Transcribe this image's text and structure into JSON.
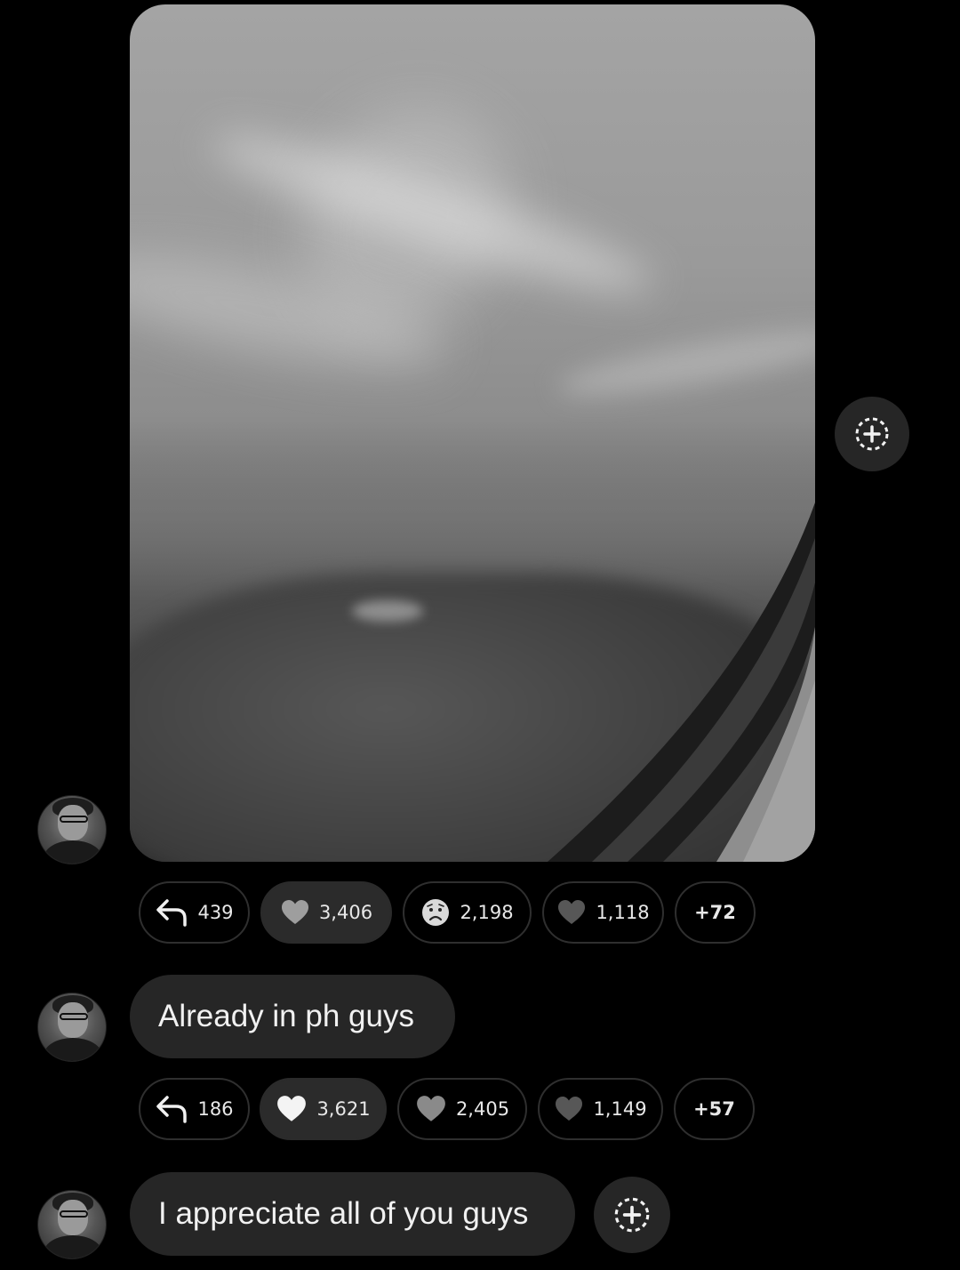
{
  "messages": [
    {
      "type": "image",
      "reactions": {
        "replies": "439",
        "heart": "3,406",
        "sad": "2,198",
        "black_heart": "1,118",
        "more": "+72"
      }
    },
    {
      "type": "text",
      "text": "Already in ph guys",
      "reactions": {
        "replies": "186",
        "heart": "3,621",
        "grey_heart": "2,405",
        "black_heart": "1,149",
        "more": "+57"
      }
    },
    {
      "type": "text",
      "text": "I appreciate all of you guys"
    }
  ],
  "icons": {
    "reply": "reply-arrow-icon",
    "heart": "heart-icon",
    "sad": "sad-face-icon",
    "react": "add-reaction-icon"
  },
  "colors": {
    "background": "#000000",
    "bubble": "#262626",
    "pill_border": "#2f2f2f",
    "pill_active": "#2b2b2b",
    "text": "#eeeeee"
  }
}
